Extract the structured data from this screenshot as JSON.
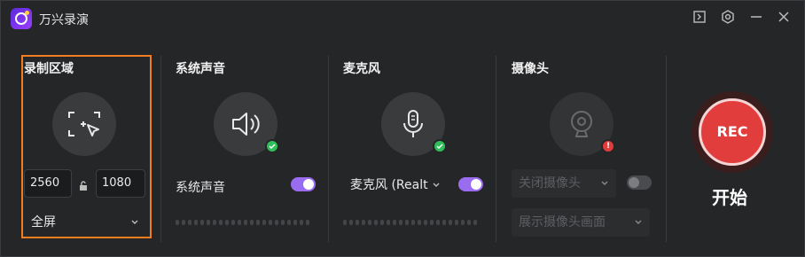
{
  "app": {
    "title": "万兴录演"
  },
  "sections": {
    "record_area": {
      "title": "录制区域",
      "width": "2560",
      "height": "1080",
      "mode_label": "全屏"
    },
    "system_audio": {
      "title": "系统声音",
      "toggle_label": "系统声音",
      "toggle_on": true
    },
    "microphone": {
      "title": "麦克风",
      "device_label": "麦克风 (Realt",
      "toggle_on": true
    },
    "camera": {
      "title": "摄像头",
      "device_label": "关闭摄像头",
      "display_label": "展示摄像头画面",
      "toggle_on": false
    }
  },
  "record": {
    "button_label": "REC",
    "start_label": "开始"
  },
  "colors": {
    "accent": "#9a6cf2",
    "rec": "#e23d3d",
    "highlight": "#f07d1f",
    "ok": "#2fbf5a",
    "error": "#e23b3b"
  }
}
